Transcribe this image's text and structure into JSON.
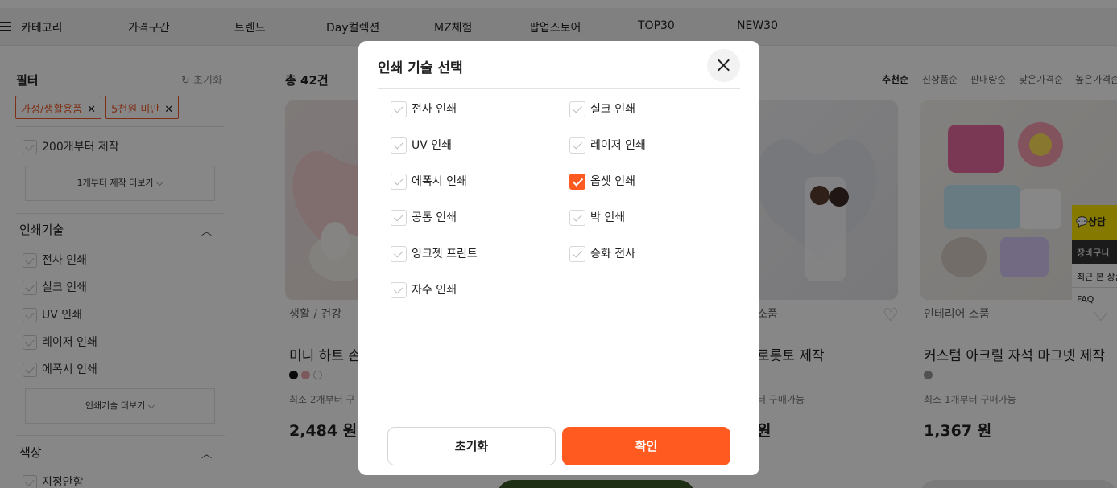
{
  "nav": {
    "category": "카테고리",
    "items": [
      "가격구간",
      "트렌드",
      "Day컬렉션",
      "MZ체험",
      "팝업스토어",
      "TOP30",
      "NEW30"
    ]
  },
  "sidebar": {
    "title": "필터",
    "reset": "초기화",
    "chips": [
      "가정/생활용품",
      "5천원 미만"
    ],
    "min_qty_option": "200개부터 제작",
    "min_qty_more": "1개부터 제작 더보기",
    "print_section": "인쇄기술",
    "print_options": [
      "전사 인쇄",
      "실크 인쇄",
      "UV 인쇄",
      "레이저 인쇄",
      "에폭시 인쇄"
    ],
    "print_more": "인쇄기술 더보기",
    "color_section": "색상",
    "color_option": "지정안함"
  },
  "main": {
    "count": "총 42건",
    "sorts": [
      "추천순",
      "신상품순",
      "판매량순",
      "낮은가격순",
      "높은가격순"
    ],
    "cards": [
      {
        "category": "생활 / 건강",
        "name": "미니 하트 손거",
        "min": "최소 2개부터 구",
        "price": "2,484 원"
      },
      {
        "category": "소품",
        "name": "로롯토 제작",
        "min": "터 구매가능",
        "price": "원"
      },
      {
        "category": "인테리어 소품",
        "name": "커스텀 아크릴 자석 마그넷 제작",
        "min": "최소 1개부터 구매가능",
        "price": "1,367 원"
      }
    ]
  },
  "side_float": {
    "kakao": "상담",
    "cart": "장바구니",
    "recent": "최근 본 상품",
    "faq": "FAQ"
  },
  "modal": {
    "title": "인쇄 기술 선택",
    "options": [
      {
        "label": "전사 인쇄",
        "checked": false
      },
      {
        "label": "실크 인쇄",
        "checked": false
      },
      {
        "label": "UV 인쇄",
        "checked": false
      },
      {
        "label": "레이저 인쇄",
        "checked": false
      },
      {
        "label": "에폭시 인쇄",
        "checked": false
      },
      {
        "label": "옵셋 인쇄",
        "checked": true
      },
      {
        "label": "공통 인쇄",
        "checked": false
      },
      {
        "label": "박 인쇄",
        "checked": false
      },
      {
        "label": "잉크젯 프린트",
        "checked": false
      },
      {
        "label": "승화 전사",
        "checked": false
      },
      {
        "label": "자수 인쇄",
        "checked": false
      }
    ],
    "reset_label": "초기화",
    "confirm_label": "확인"
  },
  "colors": {
    "accent": "#ff5a1f",
    "chip": "#f05a28"
  }
}
